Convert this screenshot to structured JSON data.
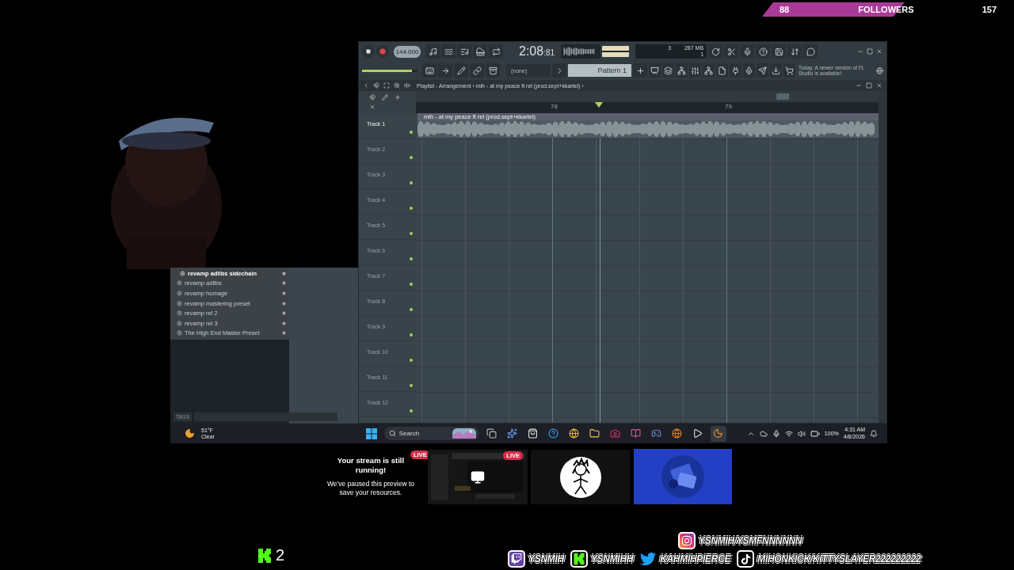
{
  "follower_goal": {
    "current": "88",
    "label": "FOLLOWERS",
    "goal": "157"
  },
  "fl_studio": {
    "transport": {
      "tempo": "144.000",
      "time_main": "2:08",
      "time_sub": ":81",
      "cpu": "3",
      "memory": "287 MB",
      "polyphony": "1"
    },
    "master_volume": {
      "level": 0.9
    },
    "pattern_selector": {
      "channel": "(none)",
      "pattern": "Pattern 1"
    },
    "news": "Today: A newer version of FL Studio is available!",
    "playlist": {
      "title": "Playlist - Arrangement › mih - at my peace ft rel (prod.sept+kkartel) ›",
      "ruler": [
        "78",
        "79"
      ],
      "clip": "mih - at my peace ft rel (prod.sept+kkartel)",
      "tracks": [
        {
          "name": "Track 1",
          "selected": true
        },
        {
          "name": "Track 2",
          "selected": false
        },
        {
          "name": "Track 3",
          "selected": false
        },
        {
          "name": "Track 4",
          "selected": false
        },
        {
          "name": "Track 5",
          "selected": false
        },
        {
          "name": "Track 6",
          "selected": false
        },
        {
          "name": "Track 7",
          "selected": false
        },
        {
          "name": "Track 8",
          "selected": false
        },
        {
          "name": "Track 9",
          "selected": false
        },
        {
          "name": "Track 10",
          "selected": false
        },
        {
          "name": "Track 11",
          "selected": false
        },
        {
          "name": "Track 12",
          "selected": false
        }
      ]
    }
  },
  "browser": {
    "items": [
      {
        "label": "revamp adlibs sidechain",
        "selected": true
      },
      {
        "label": "revamp adlibs",
        "selected": false
      },
      {
        "label": "revamp homage",
        "selected": false
      },
      {
        "label": "revamp mastering preset",
        "selected": false
      },
      {
        "label": "revamp rel 2",
        "selected": false
      },
      {
        "label": "revamp rel 3",
        "selected": false
      },
      {
        "label": "The High End Master Preset",
        "selected": false
      }
    ],
    "tags_label": "TAGS"
  },
  "taskbar": {
    "weather_temp": "51°F",
    "weather_text": "Clear",
    "search": "Search",
    "battery": "100%",
    "time": "4:31 AM",
    "date": "4/8/2026"
  },
  "stream_preview": {
    "title": "Your stream is still running!",
    "message": "We've paused this preview to save your resources.",
    "badges": [
      "LIVE",
      "LIVE"
    ]
  },
  "kick_viewers": "2",
  "socials": [
    {
      "kind": "instagram",
      "handle": "YSNMIH/YSMFNNNNNN"
    },
    {
      "kind": "twitch",
      "handle": "YSNMIH"
    },
    {
      "kind": "kick",
      "handle": "YSNMIHH"
    },
    {
      "kind": "twitter",
      "handle": "KAHMIHPIERCE"
    },
    {
      "kind": "tiktok",
      "handle": "MIHONKICK/KITTYSLAYER222222222"
    }
  ]
}
